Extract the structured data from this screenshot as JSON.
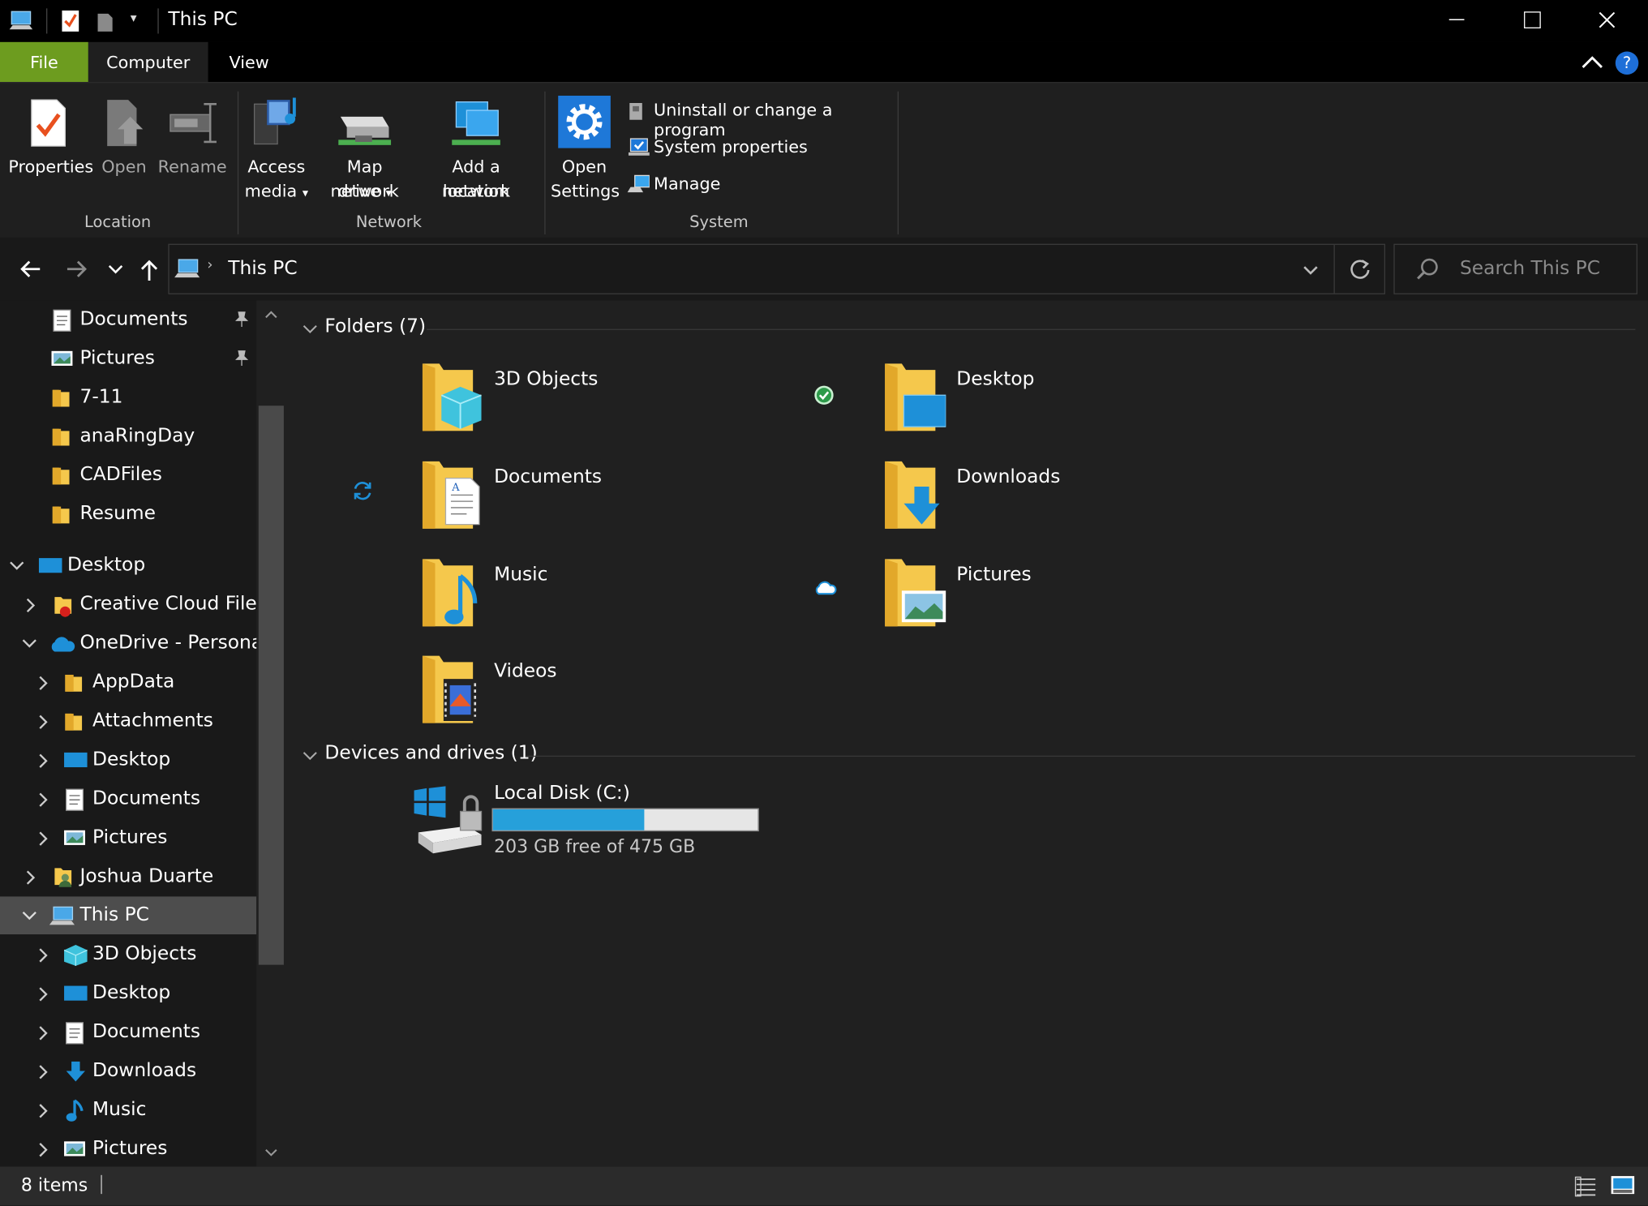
{
  "window": {
    "title": "This PC"
  },
  "tabs": [
    {
      "label": "File"
    },
    {
      "label": "Computer"
    },
    {
      "label": "View"
    }
  ],
  "ribbon": {
    "location": {
      "group_label": "Location",
      "properties": "Properties",
      "open": "Open",
      "rename": "Rename"
    },
    "network": {
      "group_label": "Network",
      "access_media_1": "Access",
      "access_media_2": "media",
      "map_drive_1": "Map network",
      "map_drive_2": "drive",
      "add_location_1": "Add a network",
      "add_location_2": "location"
    },
    "system": {
      "group_label": "System",
      "open_settings_1": "Open",
      "open_settings_2": "Settings",
      "uninstall": "Uninstall or change a program",
      "system_properties": "System properties",
      "manage": "Manage"
    }
  },
  "address": {
    "path": "This PC",
    "search_placeholder": "Search This PC"
  },
  "nav": [
    {
      "label": "Documents",
      "indent": 0
    },
    {
      "label": "Pictures",
      "indent": 0
    },
    {
      "label": "7-11",
      "indent": 0
    },
    {
      "label": "anaRingDay",
      "indent": 0
    },
    {
      "label": "CADFiles",
      "indent": 0
    },
    {
      "label": "Resume",
      "indent": 0
    },
    {
      "label": "Desktop"
    },
    {
      "label": "Creative Cloud Files"
    },
    {
      "label": "OneDrive - Personal"
    },
    {
      "label": "AppData"
    },
    {
      "label": "Attachments"
    },
    {
      "label": "Desktop"
    },
    {
      "label": "Documents"
    },
    {
      "label": "Pictures"
    },
    {
      "label": "Joshua Duarte"
    },
    {
      "label": "This PC"
    },
    {
      "label": "3D Objects"
    },
    {
      "label": "Desktop"
    },
    {
      "label": "Documents"
    },
    {
      "label": "Downloads"
    },
    {
      "label": "Music"
    },
    {
      "label": "Pictures"
    }
  ],
  "sections": {
    "folders": "Folders (7)",
    "devices": "Devices and drives (1)"
  },
  "folders": [
    {
      "label": "3D Objects"
    },
    {
      "label": "Desktop"
    },
    {
      "label": "Documents"
    },
    {
      "label": "Downloads"
    },
    {
      "label": "Music"
    },
    {
      "label": "Pictures"
    },
    {
      "label": "Videos"
    }
  ],
  "drive": {
    "label": "Local Disk (C:)",
    "free_text": "203 GB free of 475 GB",
    "used_fraction": 0.573
  },
  "status": {
    "items": "8 items"
  },
  "colors": {
    "accent": "#1e90d8",
    "file_tab": "#6d9c1f",
    "folder": "#f5c84c",
    "selected": "#4d4d4d"
  }
}
